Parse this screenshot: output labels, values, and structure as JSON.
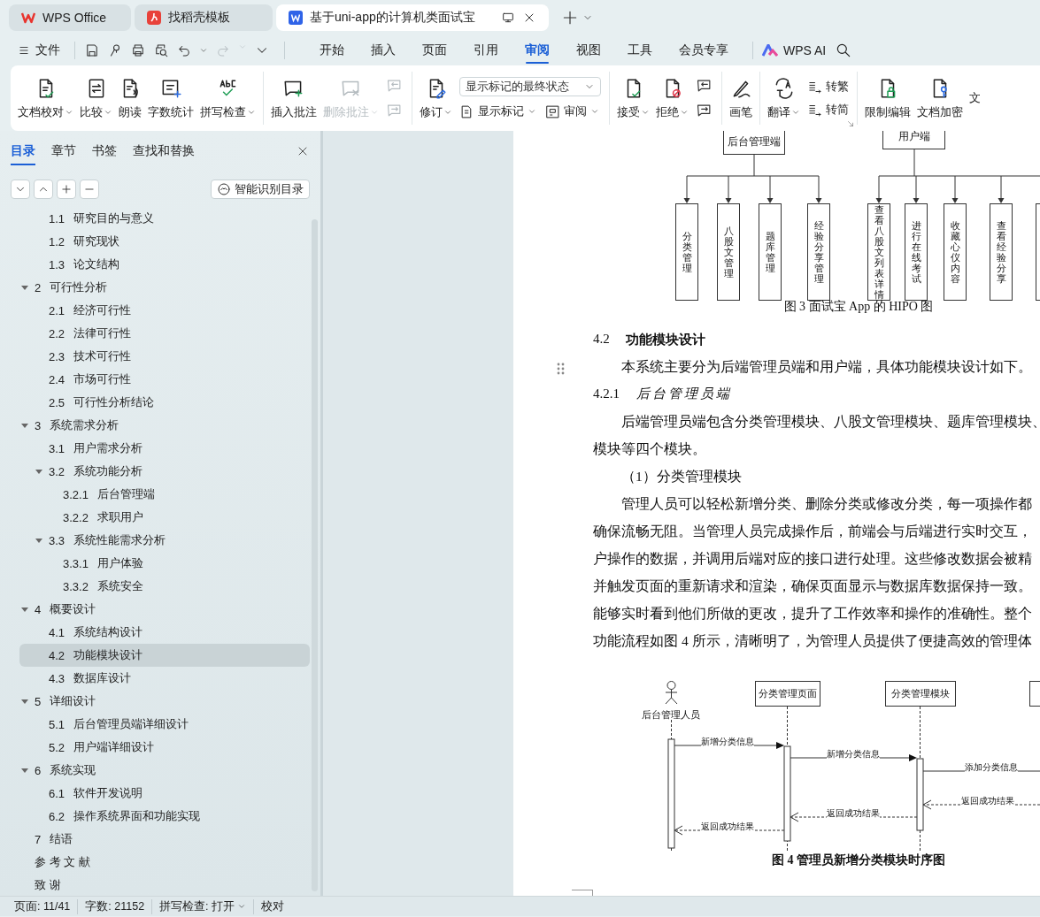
{
  "tabs": [
    {
      "label": "WPS Office",
      "selected": false
    },
    {
      "label": "找稻壳模板",
      "selected": false
    },
    {
      "label": "基于uni-app的计算机类面试宝",
      "selected": true
    }
  ],
  "menu": {
    "file": "文件",
    "tabs": [
      {
        "label": "开始",
        "selected": false
      },
      {
        "label": "插入",
        "selected": false
      },
      {
        "label": "页面",
        "selected": false
      },
      {
        "label": "引用",
        "selected": false
      },
      {
        "label": "审阅",
        "selected": true
      },
      {
        "label": "视图",
        "selected": false
      },
      {
        "label": "工具",
        "selected": false
      },
      {
        "label": "会员专享",
        "selected": false
      }
    ],
    "ai": "WPS AI"
  },
  "ribbon": [
    {
      "dialog_launcher": false,
      "items": [
        {
          "kind": "large",
          "label": "文档校对",
          "dropdown": true,
          "disabled": false
        },
        {
          "kind": "large",
          "label": "比较",
          "dropdown": true,
          "disabled": false
        },
        {
          "kind": "large",
          "label": "朗读",
          "dropdown": false,
          "disabled": false
        },
        {
          "kind": "large",
          "label": "字数统计",
          "dropdown": false,
          "disabled": false
        },
        {
          "kind": "large",
          "label": "拼写检查",
          "dropdown": true,
          "disabled": false
        }
      ]
    },
    {
      "dialog_launcher": false,
      "items": [
        {
          "kind": "large",
          "label": "插入批注",
          "dropdown": false,
          "disabled": false
        },
        {
          "kind": "large",
          "label": "删除批注",
          "dropdown": true,
          "disabled": true
        },
        {
          "kind": "stack",
          "items": [
            {
              "kind": "icon",
              "disabled": true
            },
            {
              "kind": "icon",
              "disabled": true
            }
          ]
        }
      ]
    },
    {
      "dialog_launcher": false,
      "items": [
        {
          "kind": "large",
          "label": "修订",
          "dropdown": true,
          "disabled": false
        },
        {
          "kind": "stack",
          "items": [
            {
              "kind": "select",
              "value": "显示标记的最终状态"
            },
            {
              "kind": "row",
              "items": [
                {
                  "kind": "small",
                  "label": "显示标记",
                  "dropdown": true,
                  "disabled": false
                },
                {
                  "kind": "small",
                  "label": "审阅",
                  "dropdown": true,
                  "disabled": false
                }
              ]
            }
          ]
        }
      ]
    },
    {
      "dialog_launcher": false,
      "items": [
        {
          "kind": "large",
          "label": "接受",
          "dropdown": true,
          "disabled": false
        },
        {
          "kind": "large",
          "label": "拒绝",
          "dropdown": true,
          "disabled": false
        },
        {
          "kind": "stack",
          "items": [
            {
              "kind": "icon",
              "disabled": false
            },
            {
              "kind": "icon",
              "disabled": false
            }
          ]
        }
      ]
    },
    {
      "dialog_launcher": false,
      "items": [
        {
          "kind": "large",
          "label": "画笔",
          "dropdown": false,
          "disabled": false
        }
      ]
    },
    {
      "dialog_launcher": true,
      "items": [
        {
          "kind": "large",
          "label": "翻译",
          "dropdown": true,
          "disabled": false
        },
        {
          "kind": "stack",
          "items": [
            {
              "kind": "small",
              "label": "转繁",
              "dropdown": false,
              "disabled": false
            },
            {
              "kind": "small",
              "label": "转简",
              "dropdown": false,
              "disabled": false
            }
          ]
        }
      ]
    },
    {
      "dialog_launcher": false,
      "items": [
        {
          "kind": "large",
          "label": "限制编辑",
          "dropdown": false,
          "disabled": false
        },
        {
          "kind": "large",
          "label": "文档加密",
          "dropdown": false,
          "disabled": false
        },
        {
          "kind": "large",
          "label": "文",
          "dropdown": false,
          "disabled": false
        }
      ]
    }
  ],
  "sidebar": {
    "tabs": [
      {
        "label": "目录",
        "selected": true
      },
      {
        "label": "章节",
        "selected": false
      },
      {
        "label": "书签",
        "selected": false
      },
      {
        "label": "查找和替换",
        "selected": false
      }
    ],
    "smart_toc": "智能识别目录",
    "toc": {
      "continued": [
        {
          "number": "1.1",
          "title": "研究目的与意义",
          "selected": false
        },
        {
          "number": "1.2",
          "title": "研究现状",
          "selected": false
        },
        {
          "number": "1.3",
          "title": "论文结构",
          "selected": false
        }
      ],
      "items": [
        {
          "number": "2",
          "title": "可行性分析",
          "expanded": true,
          "selected": false,
          "children": [
            {
              "number": "2.1",
              "title": "经济可行性",
              "selected": false
            },
            {
              "number": "2.2",
              "title": "法律可行性",
              "selected": false
            },
            {
              "number": "2.3",
              "title": "技术可行性",
              "selected": false
            },
            {
              "number": "2.4",
              "title": "市场可行性",
              "selected": false
            },
            {
              "number": "2.5",
              "title": "可行性分析结论",
              "selected": false
            }
          ]
        },
        {
          "number": "3",
          "title": "系统需求分析",
          "expanded": true,
          "selected": false,
          "children": [
            {
              "number": "3.1",
              "title": "用户需求分析",
              "selected": false
            },
            {
              "number": "3.2",
              "title": "系统功能分析",
              "expanded": true,
              "selected": false,
              "children": [
                {
                  "number": "3.2.1",
                  "title": "后台管理端",
                  "selected": false
                },
                {
                  "number": "3.2.2",
                  "title": "求职用户",
                  "selected": false
                }
              ]
            },
            {
              "number": "3.3",
              "title": "系统性能需求分析",
              "expanded": true,
              "selected": false,
              "children": [
                {
                  "number": "3.3.1",
                  "title": "用户体验",
                  "selected": false
                },
                {
                  "number": "3.3.2",
                  "title": "系统安全",
                  "selected": false
                }
              ]
            }
          ]
        },
        {
          "number": "4",
          "title": "概要设计",
          "expanded": true,
          "selected": false,
          "children": [
            {
              "number": "4.1",
              "title": "系统结构设计",
              "selected": false
            },
            {
              "number": "4.2",
              "title": "功能模块设计",
              "selected": true
            },
            {
              "number": "4.3",
              "title": "数据库设计",
              "selected": false
            }
          ]
        },
        {
          "number": "5",
          "title": "详细设计",
          "expanded": true,
          "selected": false,
          "children": [
            {
              "number": "5.1",
              "title": "后台管理员端详细设计",
              "selected": false
            },
            {
              "number": "5.2",
              "title": "用户端详细设计",
              "selected": false
            }
          ]
        },
        {
          "number": "6",
          "title": "系统实现",
          "expanded": true,
          "selected": false,
          "children": [
            {
              "number": "6.1",
              "title": "软件开发说明",
              "selected": false
            },
            {
              "number": "6.2",
              "title": "操作系统界面和功能实现",
              "selected": false
            }
          ]
        },
        {
          "number": "7",
          "title": "结语",
          "selected": false
        },
        {
          "title": "参 考 文 献",
          "selected": false
        },
        {
          "title": "致   谢",
          "selected": false
        }
      ]
    }
  },
  "document": {
    "figure3": {
      "roots": [
        {
          "label": "后台管理端",
          "children": [
            "分类管理",
            "八股文管理",
            "题库管理",
            "经验分享管理"
          ]
        },
        {
          "label": "用户端",
          "children": [
            "查看八股文列表详情",
            "进行在线考试",
            "收藏心仪内容",
            "查看经验分享"
          ]
        }
      ],
      "caption": "图 3 面试宝 App 的 HIPO 图"
    },
    "blocks": [
      {
        "kind": "heading",
        "number": "4.2",
        "text": "功能模块设计"
      },
      {
        "kind": "paragraph",
        "lines": [
          "本系统主要分为后端管理员端和用户端，具体功能模块设计如下。"
        ]
      },
      {
        "kind": "subheading",
        "number": "4.2.1",
        "text": "后台管理员端"
      },
      {
        "kind": "paragraph",
        "lines": [
          "后端管理员端包含分类管理模块、八股文管理模块、题库管理模块、",
          "模块等四个模块。"
        ]
      },
      {
        "kind": "item",
        "text": "（1）分类管理模块"
      },
      {
        "kind": "paragraph",
        "lines": [
          "管理人员可以轻松新增分类、删除分类或修改分类，每一项操作都",
          "确保流畅无阻。当管理人员完成操作后，前端会与后端进行实时交互，",
          "户操作的数据，并调用后端对应的接口进行处理。这些修改数据会被精",
          "并触发页面的重新请求和渲染，确保页面显示与数据库数据保持一致。",
          "能够实时看到他们所做的更改，提升了工作效率和操作的准确性。整个",
          "功能流程如图 4 所示，清晰明了，为管理人员提供了便捷高效的管理体"
        ]
      }
    ],
    "figure4": {
      "actor": "后台管理人员",
      "lifelines": [
        "分类管理页面",
        "分类管理模块"
      ],
      "messages": [
        {
          "label": "新增分类信息",
          "kind": "call"
        },
        {
          "label": "新增分类信息",
          "kind": "call"
        },
        {
          "label": "添加分类信息",
          "kind": "call"
        },
        {
          "label": "返回成功结果",
          "kind": "return"
        },
        {
          "label": "返回成功结果",
          "kind": "return"
        },
        {
          "label": "返回成功结果",
          "kind": "return"
        }
      ],
      "caption": "图 4 管理员新增分类模块时序图"
    }
  },
  "status_bar": [
    {
      "label": "页面: 11/41",
      "dropdown": false
    },
    {
      "label": "字数: 21152",
      "dropdown": false
    },
    {
      "label": "拼写检查: 打开",
      "dropdown": true
    },
    {
      "label": "校对",
      "dropdown": false
    }
  ]
}
